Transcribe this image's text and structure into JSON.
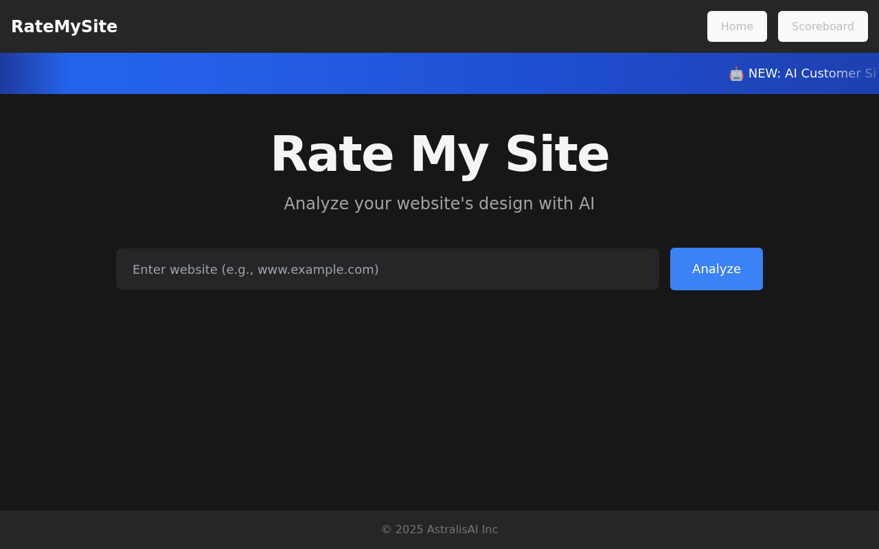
{
  "header": {
    "logo": "RateMySite",
    "nav_buttons": [
      "Home",
      "Scoreboard"
    ]
  },
  "banner": {
    "text": "NEW: AI Customer Si"
  },
  "hero": {
    "title": "Rate My Site",
    "subtitle": "Analyze your website's design with AI"
  },
  "search": {
    "placeholder": "Enter website (e.g., www.example.com)",
    "button": "Analyze"
  },
  "footer": {
    "text": "© 2025 AstralisAI Inc"
  }
}
